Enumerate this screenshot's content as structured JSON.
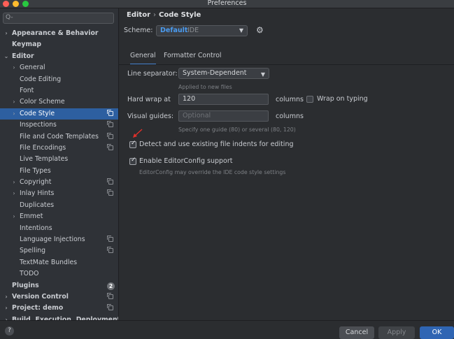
{
  "window": {
    "title": "Preferences"
  },
  "search": {
    "placeholder": "Q-"
  },
  "sidebar": {
    "items": [
      {
        "label": "Appearance & Behavior",
        "arrow": "›",
        "bold": true
      },
      {
        "label": "Keymap",
        "bold": true
      },
      {
        "label": "Editor",
        "arrow": "⌄",
        "bold": true
      },
      {
        "label": "General",
        "arrow": "›"
      },
      {
        "label": "Code Editing"
      },
      {
        "label": "Font"
      },
      {
        "label": "Color Scheme",
        "arrow": "›"
      },
      {
        "label": "Code Style",
        "arrow": "›",
        "selected": true,
        "copy": true
      },
      {
        "label": "Inspections",
        "copy": true
      },
      {
        "label": "File and Code Templates",
        "copy": true
      },
      {
        "label": "File Encodings",
        "copy": true
      },
      {
        "label": "Live Templates"
      },
      {
        "label": "File Types"
      },
      {
        "label": "Copyright",
        "arrow": "›",
        "copy": true
      },
      {
        "label": "Inlay Hints",
        "arrow": "›",
        "copy": true
      },
      {
        "label": "Duplicates"
      },
      {
        "label": "Emmet",
        "arrow": "›"
      },
      {
        "label": "Intentions"
      },
      {
        "label": "Language Injections",
        "copy": true
      },
      {
        "label": "Spelling",
        "copy": true
      },
      {
        "label": "TextMate Bundles"
      },
      {
        "label": "TODO"
      },
      {
        "label": "Plugins",
        "bold": true,
        "badge": "2"
      },
      {
        "label": "Version Control",
        "arrow": "›",
        "bold": true,
        "copy": true
      },
      {
        "label": "Project: demo",
        "arrow": "›",
        "bold": true,
        "copy": true
      },
      {
        "label": "Build, Execution, Deployment",
        "arrow": "›",
        "bold": true
      }
    ]
  },
  "header": {
    "crumb1": "Editor",
    "sep": "›",
    "crumb2": "Code Style"
  },
  "scheme": {
    "label": "Scheme:",
    "value": "Default",
    "sub": "IDE"
  },
  "tabs": [
    {
      "label": "General",
      "active": true
    },
    {
      "label": "Formatter Control"
    }
  ],
  "general": {
    "line_separator_label": "Line separator:",
    "line_separator_value": "System-Dependent",
    "line_separator_hint": "Applied to new files",
    "hard_wrap_label": "Hard wrap at",
    "hard_wrap_value": "120",
    "hard_wrap_unit": "columns",
    "wrap_on_typing_label": "Wrap on typing",
    "visual_guides_label": "Visual guides:",
    "visual_guides_placeholder": "Optional",
    "visual_guides_unit": "columns",
    "visual_guides_hint": "Specify one guide (80) or several (80, 120)",
    "detect_indents_label": "Detect and use existing file indents for editing",
    "editorconfig_label": "Enable EditorConfig support",
    "editorconfig_hint": "EditorConfig may override the IDE code style settings"
  },
  "buttons": {
    "help": "?",
    "cancel": "Cancel",
    "apply": "Apply",
    "ok": "OK"
  },
  "colors": {
    "accent": "#4a9bf0",
    "selection": "#2d5fa0",
    "annotation_arrow": "#e0302a"
  }
}
